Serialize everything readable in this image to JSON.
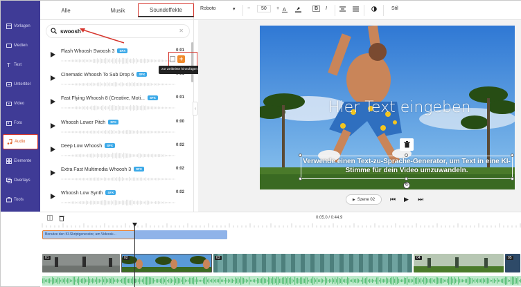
{
  "nav": {
    "items": [
      {
        "label": "Vorlagen",
        "icon": "layout-icon"
      },
      {
        "label": "Medien",
        "icon": "media-icon"
      },
      {
        "label": "Text",
        "icon": "text-icon"
      },
      {
        "label": "Untertitel",
        "icon": "subtitle-icon"
      },
      {
        "label": "Video",
        "icon": "video-icon"
      },
      {
        "label": "Foto",
        "icon": "photo-icon"
      },
      {
        "label": "Audio",
        "icon": "audio-icon",
        "active": true
      },
      {
        "label": "Elemente",
        "icon": "elements-icon"
      },
      {
        "label": "Overlays",
        "icon": "overlays-icon"
      },
      {
        "label": "Tools",
        "icon": "tools-icon"
      }
    ]
  },
  "panel": {
    "tabs": [
      {
        "label": "Alle"
      },
      {
        "label": "Musik"
      },
      {
        "label": "Soundeffekte",
        "active": true
      }
    ],
    "search_value": "swoosh",
    "sfx_badge": "SFX",
    "sounds": [
      {
        "title": "Flash Whoosh Swoosh 3",
        "duration": "0:01"
      },
      {
        "title": "Cinematic Whoosh To Sub Drop 6",
        "duration": "0:01"
      },
      {
        "title": "Fast Flying Whoosh 8 (Creative, Moti...",
        "duration": "0:01"
      },
      {
        "title": "Whoosh Lower Pitch",
        "duration": "0:00"
      },
      {
        "title": "Deep Low Whoosh",
        "duration": "0:02"
      },
      {
        "title": "Extra Fast Multimedia Whoosh 3",
        "duration": "0:02"
      },
      {
        "title": "Whoosh Low Synth",
        "duration": "0:02"
      }
    ],
    "tooltip": "zur Zeitleiste hinzufügen",
    "add_symbol": "+"
  },
  "toolbar": {
    "font": "Roboto",
    "font_size": "50",
    "minus": "−",
    "plus": "+",
    "bold": "B",
    "italic": "I",
    "style_label": "Stil"
  },
  "preview": {
    "headline": "Hier Text eingeben",
    "subtitle": "Verwende einen Text-zu-Sprache-Generator, um Text in eine KI-Stimme für dein Video umzuwandeln.",
    "scene_label": "Szene 02"
  },
  "timeline": {
    "time_display": "0:05.0 / 0:44.9",
    "text_track_label": "Benutze den KI-Skriptgenerator, um Videosk...",
    "scenes": [
      "01",
      "02",
      "03",
      "04",
      "05"
    ]
  },
  "colors": {
    "nav_bg": "#3f3b96",
    "accent_orange": "#f08a2c",
    "highlight_red": "#d6362e",
    "sfx_badge": "#3ba9e8",
    "audio_track": "#bfeacc",
    "text_track": "#a8c7ef"
  }
}
